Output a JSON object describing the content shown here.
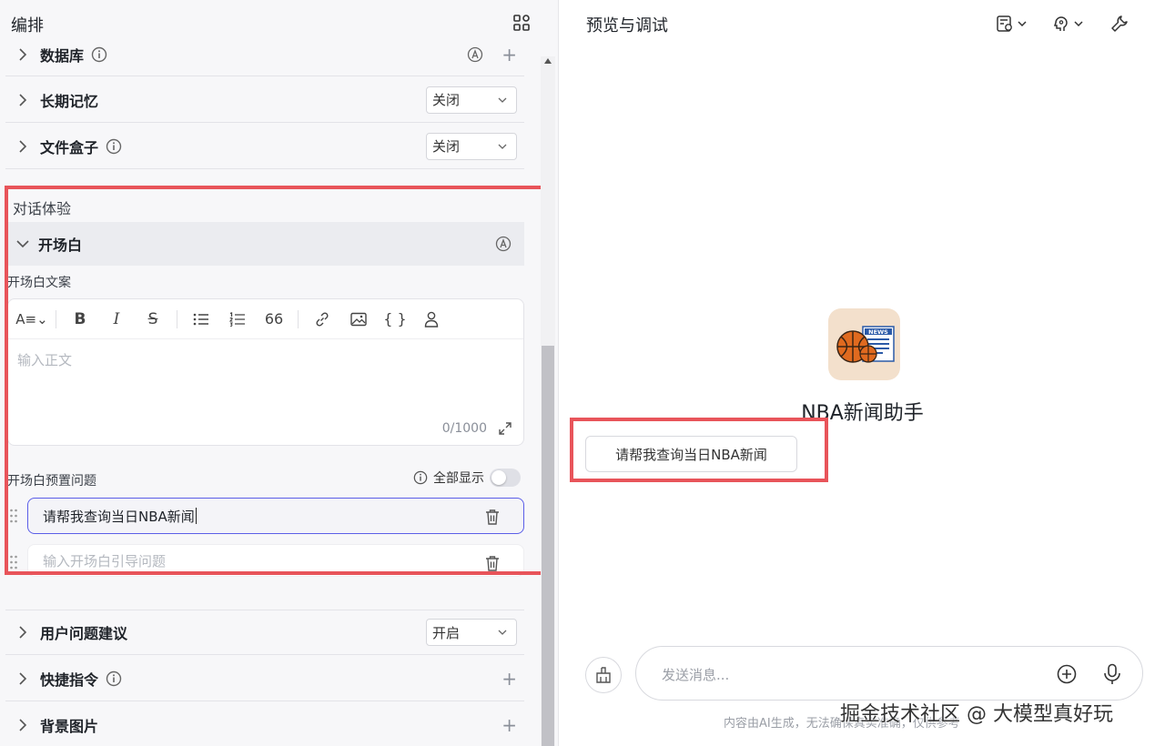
{
  "left": {
    "title": "编排",
    "rows": {
      "database": {
        "label": "数据库"
      },
      "longterm": {
        "label": "长期记忆",
        "select": "关闭"
      },
      "filebox": {
        "label": "文件盒子",
        "select": "关闭"
      },
      "suggest": {
        "label": "用户问题建议",
        "select": "开启"
      },
      "shortcut": {
        "label": "快捷指令"
      },
      "background": {
        "label": "背景图片"
      }
    },
    "section_title": "对话体验",
    "opening": {
      "label": "开场白",
      "copy_label": "开场白文案",
      "editor_placeholder": "输入正文",
      "counter": "0/1000",
      "preset_label": "开场白预置问题",
      "show_all": "全部显示",
      "questions": [
        "请帮我查询当日NBA新闻"
      ],
      "new_question_placeholder": "输入开场白引导问题"
    }
  },
  "right": {
    "title": "预览与调试",
    "bot_name": "NBA新闻助手",
    "suggestion": "请帮我查询当日NBA新闻",
    "message_placeholder": "发送消息...",
    "disclaimer": "内容由AI生成，无法确保真实准确，仅供参考",
    "watermark": "掘金技术社区 @ 大模型真好玩",
    "avatar_badge": "NEWS"
  },
  "colors": {
    "highlight": "#e8545a",
    "accent": "#5b5ee8"
  }
}
